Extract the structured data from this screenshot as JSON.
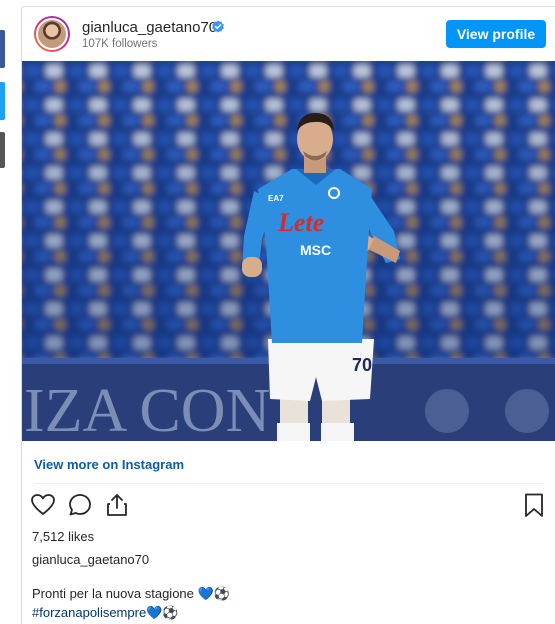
{
  "embed": {
    "username": "gianluca_gaetano70",
    "followers": "107K followers",
    "view_profile_label": "View profile",
    "view_more_label": "View more on Instagram",
    "likes": "7,512 likes",
    "post_username": "gianluca_gaetano70",
    "caption_text": "Pronti per la nuova stagione ",
    "caption_emojis": "💙⚽",
    "hashtag": "#forzanapolisempre",
    "hashtag_emojis": "💙⚽"
  },
  "photo": {
    "jersey_sponsor": "Lete",
    "jersey_sponsor2": "MSC",
    "kit_brand": "EA7",
    "shorts_number": "70",
    "banner_text": "IZA CON"
  },
  "colors": {
    "accent": "#0095f6",
    "link": "#0a5ea8",
    "hashtag": "#00376b",
    "share_facebook": "#3b5998",
    "share_twitter": "#1da1f2",
    "share_other": "#555555",
    "jersey": "#2e8fe0"
  },
  "icons": {
    "like": "heart-outline-icon",
    "comment": "comment-bubble-icon",
    "share": "share-upload-icon",
    "save": "bookmark-icon",
    "verified": "verified-badge-icon"
  }
}
